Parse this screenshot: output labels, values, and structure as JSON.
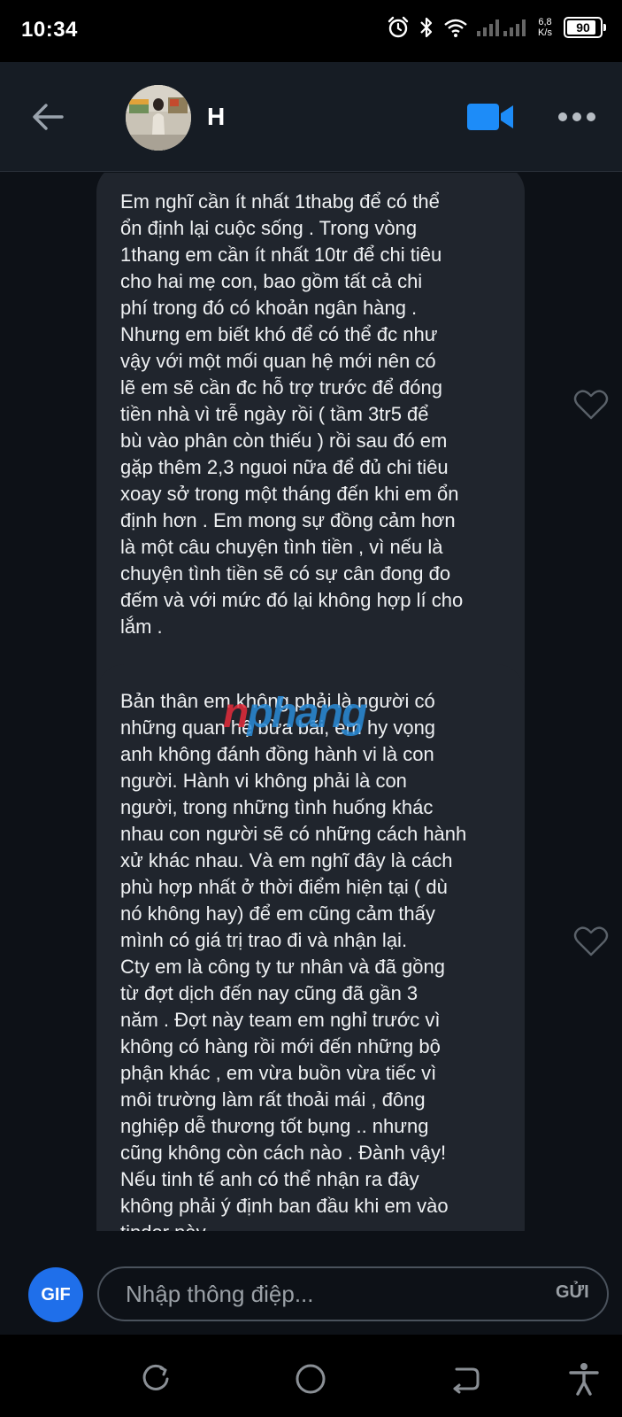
{
  "status_bar": {
    "time": "10:34",
    "net_speed_value": "6,8",
    "net_speed_unit": "K/s",
    "battery": "90",
    "battery_level": 0.9,
    "icons": [
      "alarm-icon",
      "bluetooth-icon",
      "wifi-icon",
      "signal-icon",
      "battery-icon"
    ]
  },
  "header": {
    "contact_name": "H",
    "icons": [
      "back-arrow-icon",
      "avatar",
      "video-call-icon",
      "more-icon"
    ],
    "accent_color": "#1d8cf8"
  },
  "messages": [
    {
      "text": "Em nghĩ cần ít nhất 1thabg để có thể\nổn định lại cuộc sống . Trong vòng\n1thang em cần ít nhất 10tr để chi tiêu\ncho hai mẹ con,  bao gồm tất cả chi\nphí trong đó có khoản ngân hàng .\nNhưng em biết khó để có thể đc như\nvậy với một mối quan hệ mới nên có\nlẽ em sẽ cần đc hỗ trợ trước để đóng\ntiền nhà vì trễ ngày rồi ( tầm 3tr5 để\nbù vào phân còn thiếu ) rồi sau đó em\ngặp thêm 2,3 nguoi nữa để đủ chi tiêu\nxoay sở trong một tháng đến khi em ổn\nđịnh hơn . Em mong sự đồng cảm hơn\nlà một câu chuyện tình tiền , vì nếu là\nchuyện tình tiền sẽ có sự cân đong đo\nđếm và với mức đó lại không hợp lí cho\nlắm ."
    },
    {
      "text": "Bản thân em không phải là người có\nnhững quan hệ bừa bãi, em hy vọng\nanh không đánh đồng hành vi là con\nngười. Hành vi không phải là con\nngười, trong những tình huống khác\nnhau con người sẽ có những cách hành\nxử khác nhau. Và em nghĩ đây là cách\nphù hợp nhất ở thời điểm hiện tại ( dù\nnó không hay) để em cũng cảm thấy\nmình có giá trị trao đi và nhận lại.\nCty em là công ty tư nhân và đã gồng\ntừ đợt dịch đến nay cũng đã gần 3\nnăm . Đợt này team em nghỉ trước vì\nkhông có hàng rồi mới đến những bộ\nphận khác , em vừa buồn vừa tiếc vì\nmôi trường làm rất thoải mái , đông\nnghiệp dễ thương tốt bụng .. nhưng\ncũng không còn cách nào . Đành vậy!\nNếu tinh tế anh có thể nhận ra đây\nkhông phải ý định ban đầu khi em vào\ntinder này"
    }
  ],
  "watermark": {
    "part1": "n",
    "part2": "phang"
  },
  "composer": {
    "gif_label": "GIF",
    "placeholder": "Nhập thông điệp...",
    "send_label": "GỬI"
  },
  "nav_bar": {
    "icons": [
      "recent-apps-icon",
      "home-icon",
      "back-icon",
      "accessibility-icon"
    ]
  }
}
